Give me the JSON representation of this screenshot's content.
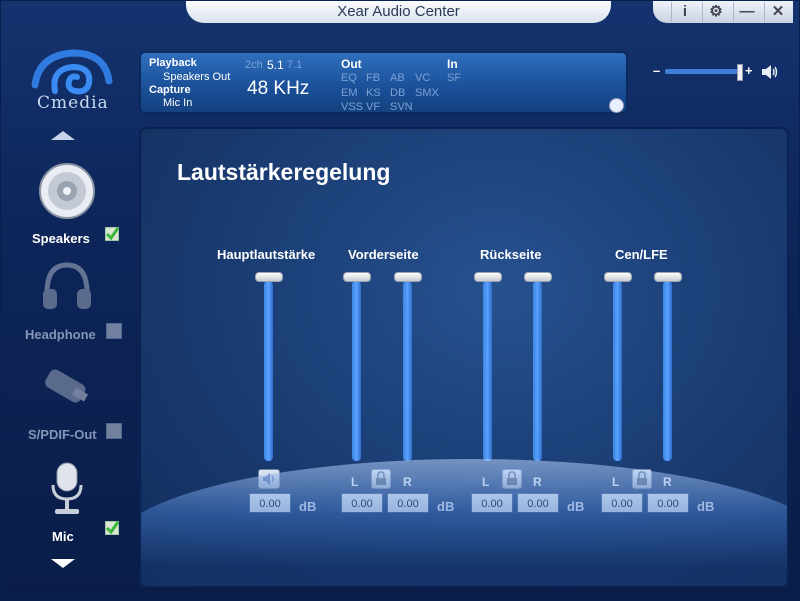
{
  "window": {
    "title": "Xear Audio Center",
    "buttons": [
      "i",
      "⚙",
      "—",
      "✕"
    ]
  },
  "sidebar": {
    "logo_text": "Cmedia",
    "devices": [
      {
        "label": "Speakers",
        "checked": true,
        "active": true
      },
      {
        "label": "Headphone",
        "checked": false,
        "active": false
      },
      {
        "label": "S/PDIF-Out",
        "checked": false,
        "active": false
      },
      {
        "label": "Mic",
        "checked": true,
        "active": true
      }
    ]
  },
  "status": {
    "playback_label": "Playback",
    "playback_device": "Speakers Out",
    "capture_label": "Capture",
    "capture_device": "Mic In",
    "channels_dim_left": "2ch",
    "channels": "5.1",
    "channels_dim_right": "7.1",
    "frequency": "48 KHz",
    "out_label": "Out",
    "out_effects": [
      "EQ",
      "FB",
      "AB",
      "VC",
      "EM",
      "KS",
      "DB",
      "SMX",
      "VSS",
      "VF",
      "SVN"
    ],
    "in_label": "In",
    "in_effects": [
      "SF"
    ]
  },
  "master_volume": {
    "minus": "–",
    "plus": "+",
    "level": 0.95
  },
  "main": {
    "title": "Lautstärkeregelung",
    "groups": [
      {
        "label": "Hauptlautstärke",
        "value": "0.00",
        "unit": "dB"
      },
      {
        "label": "Vorderseite",
        "left_label": "L",
        "right_label": "R",
        "left": "0.00",
        "right": "0.00",
        "unit": "dB"
      },
      {
        "label": "Rückseite",
        "left_label": "L",
        "right_label": "R",
        "left": "0.00",
        "right": "0.00",
        "unit": "dB"
      },
      {
        "label": "Cen/LFE",
        "left_label": "L",
        "right_label": "R",
        "left": "0.00",
        "right": "0.00",
        "unit": "dB"
      }
    ]
  }
}
